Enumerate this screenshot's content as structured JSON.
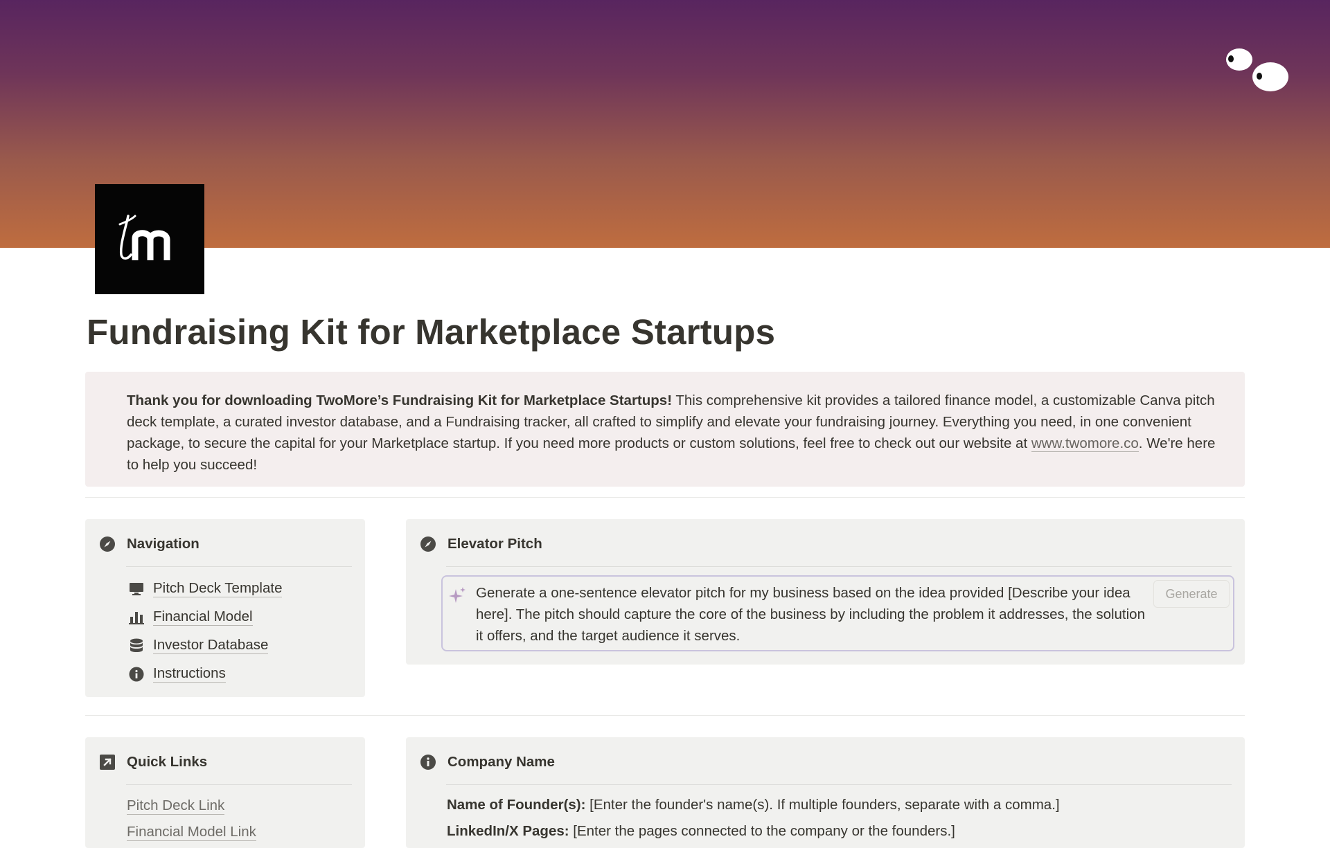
{
  "page": {
    "title": "Fundraising Kit for Marketplace Startups"
  },
  "callout": {
    "bold_text": "Thank you for downloading TwoMore’s Fundraising Kit for Marketplace Startups!",
    "body_text": " This comprehensive kit provides a tailored finance model, a customizable Canva pitch deck template, a curated investor database, and a Fundraising tracker, all crafted to simplify and elevate your fundraising journey. Everything you need, in one convenient package, to secure the capital for your Marketplace startup. If you need more products or custom solutions, feel free to check out our website at ",
    "link_text": "www.twomore.co",
    "tail_text": ". We're here to help you succeed!"
  },
  "navigation": {
    "title": "Navigation",
    "icon": "compass-icon",
    "items": [
      {
        "label": "Pitch Deck Template",
        "icon": "monitor-icon"
      },
      {
        "label": "Financial Model",
        "icon": "bar-chart-icon"
      },
      {
        "label": "Investor Database",
        "icon": "database-icon"
      },
      {
        "label": "Instructions",
        "icon": "info-icon"
      }
    ]
  },
  "elevator_pitch": {
    "title": "Elevator Pitch",
    "icon": "compass-icon",
    "prompt": "Generate a one-sentence elevator pitch for my business based on the idea provided [Describe your idea here]. The pitch should capture the core of the business by including the problem it addresses, the solution it offers, and the target audience it serves.",
    "button_label": "Generate"
  },
  "quick_links": {
    "title": "Quick Links",
    "icon": "arrow-up-right-icon",
    "items": [
      {
        "label": "Pitch Deck Link"
      },
      {
        "label": "Financial Model Link"
      }
    ]
  },
  "company_name": {
    "title": "Company Name",
    "icon": "info-icon",
    "fields": [
      {
        "label": "Name of Founder(s):",
        "value": " [Enter the founder's name(s). If multiple founders, separate with a comma.]"
      },
      {
        "label": "LinkedIn/X Pages:",
        "value": " [Enter the pages connected to the company or the founders.]"
      }
    ]
  },
  "colors": {
    "cover_top": "#58255f",
    "cover_bottom": "#bf6d3f",
    "callout_bg": "#f4eeee",
    "card_bg": "#f1f1ef",
    "text": "#37352f"
  }
}
